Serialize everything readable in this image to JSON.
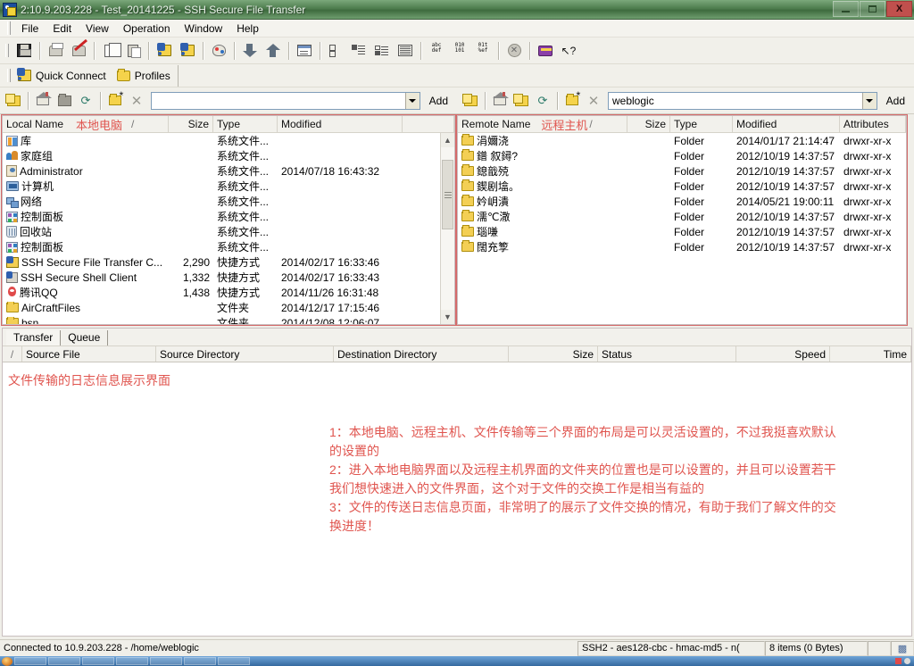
{
  "window": {
    "title": "2:10.9.203.228 - Test_20141225 - SSH Secure File Transfer",
    "icon": "ssh-file-transfer-icon",
    "minimize_label": "Minimize",
    "maximize_label": "Maximize",
    "close_label": "X"
  },
  "menu": {
    "items": [
      {
        "label": "File"
      },
      {
        "label": "Edit"
      },
      {
        "label": "View"
      },
      {
        "label": "Operation"
      },
      {
        "label": "Window"
      },
      {
        "label": "Help"
      }
    ]
  },
  "toolbar": {
    "buttons": [
      {
        "name": "save-icon"
      },
      {
        "name": "print-icon"
      },
      {
        "name": "print-preview-icon"
      },
      {
        "name": "copy-icon"
      },
      {
        "name": "paste-icon"
      },
      {
        "name": "new-terminal-icon"
      },
      {
        "name": "new-file-transfer-icon"
      },
      {
        "name": "settings-palette-icon"
      },
      {
        "name": "download-arrow-icon"
      },
      {
        "name": "upload-arrow-icon"
      },
      {
        "name": "window-view-icon"
      },
      {
        "name": "view-large-icons-icon"
      },
      {
        "name": "view-small-icons-icon"
      },
      {
        "name": "view-list-icon"
      },
      {
        "name": "view-details-icon"
      },
      {
        "name": "ascii-mode-icon"
      },
      {
        "name": "binary-mode-icon"
      },
      {
        "name": "auto-mode-icon"
      },
      {
        "name": "stop-icon"
      },
      {
        "name": "help-book-icon"
      },
      {
        "name": "context-help-icon"
      }
    ],
    "ascii_lines": [
      "abc",
      "def"
    ],
    "binary_lines": [
      "010",
      "101"
    ],
    "auto_lines": [
      "01t",
      "%ef"
    ]
  },
  "quickbar": {
    "quick_connect": "Quick Connect",
    "profiles": "Profiles"
  },
  "address": {
    "local": {
      "value": "",
      "placeholder": "",
      "add_label": "Add",
      "buttons": [
        {
          "name": "up-one-level-icon"
        },
        {
          "name": "home-icon"
        },
        {
          "name": "go-to-folder-icon"
        },
        {
          "name": "refresh-icon"
        },
        {
          "name": "new-folder-icon"
        },
        {
          "name": "delete-icon"
        }
      ]
    },
    "remote": {
      "value": "weblogic",
      "placeholder": "",
      "add_label": "Add",
      "buttons": [
        {
          "name": "up-one-level-icon"
        },
        {
          "name": "home-icon"
        },
        {
          "name": "go-to-folder-icon"
        },
        {
          "name": "refresh-icon"
        },
        {
          "name": "new-folder-icon"
        },
        {
          "name": "delete-icon"
        }
      ]
    }
  },
  "local_pane": {
    "annotation": "本地电脑",
    "sort_indicator": "/",
    "columns": [
      "Local Name",
      "Size",
      "Type",
      "Modified",
      ""
    ],
    "rows": [
      {
        "icon": "library-icon",
        "name": "库",
        "size": "",
        "type": "系统文件...",
        "modified": ""
      },
      {
        "icon": "homegroup-icon",
        "name": "家庭组",
        "size": "",
        "type": "系统文件...",
        "modified": ""
      },
      {
        "icon": "user-icon",
        "name": "Administrator",
        "size": "",
        "type": "系统文件...",
        "modified": "2014/07/18 16:43:32"
      },
      {
        "icon": "computer-icon",
        "name": "计算机",
        "size": "",
        "type": "系统文件...",
        "modified": ""
      },
      {
        "icon": "network-icon",
        "name": "网络",
        "size": "",
        "type": "系统文件...",
        "modified": ""
      },
      {
        "icon": "control-panel-icon",
        "name": "控制面板",
        "size": "",
        "type": "系统文件...",
        "modified": ""
      },
      {
        "icon": "recycle-bin-icon",
        "name": "回收站",
        "size": "",
        "type": "系统文件...",
        "modified": ""
      },
      {
        "icon": "control-panel-icon",
        "name": "控制面板",
        "size": "",
        "type": "系统文件...",
        "modified": ""
      },
      {
        "icon": "ssh-transfer-icon",
        "name": "SSH Secure File Transfer C...",
        "size": "2,290",
        "type": "快捷方式",
        "modified": "2014/02/17 16:33:46"
      },
      {
        "icon": "ssh-shell-icon",
        "name": "SSH Secure Shell Client",
        "size": "1,332",
        "type": "快捷方式",
        "modified": "2014/02/17 16:33:43"
      },
      {
        "icon": "qq-icon",
        "name": "腾讯QQ",
        "size": "1,438",
        "type": "快捷方式",
        "modified": "2014/11/26 16:31:48"
      },
      {
        "icon": "folder-icon",
        "name": "AirCraftFiles",
        "size": "",
        "type": "文件夹",
        "modified": "2014/12/17 17:15:46"
      },
      {
        "icon": "folder-icon",
        "name": "bsn",
        "size": "",
        "type": "文件夹",
        "modified": "2014/12/08 12:06:07"
      }
    ]
  },
  "remote_pane": {
    "annotation": "远程主机",
    "sort_indicator": "/",
    "columns": [
      "Remote Name",
      "Size",
      "Type",
      "Modified",
      "Attributes"
    ],
    "rows": [
      {
        "icon": "folder-icon",
        "name": "涓嬭浇",
        "size": "",
        "type": "Folder",
        "modified": "2014/01/17 21:14:47",
        "attributes": "drwxr-xr-x"
      },
      {
        "icon": "folder-icon",
        "name": "鐠  叙鐞?",
        "size": "",
        "type": "Folder",
        "modified": "2012/10/19 14:37:57",
        "attributes": "drwxr-xr-x"
      },
      {
        "icon": "folder-icon",
        "name": "鎴戠殑",
        "size": "",
        "type": "Folder",
        "modified": "2012/10/19 14:37:57",
        "attributes": "drwxr-xr-x"
      },
      {
        "icon": "folder-icon",
        "name": "鍥剧墖。",
        "size": "",
        "type": "Folder",
        "modified": "2012/10/19 14:37:57",
        "attributes": "drwxr-xr-x"
      },
      {
        "icon": "folder-icon",
        "name": "妗岄潰",
        "size": "",
        "type": "Folder",
        "modified": "2014/05/21 19:00:11",
        "attributes": "drwxr-xr-x"
      },
      {
        "icon": "folder-icon",
        "name": "濡℃潵",
        "size": "",
        "type": "Folder",
        "modified": "2012/10/19 14:37:57",
        "attributes": "drwxr-xr-x"
      },
      {
        "icon": "folder-icon",
        "name": "瑙嗛",
        "size": "",
        "type": "Folder",
        "modified": "2012/10/19 14:37:57",
        "attributes": "drwxr-xr-x"
      },
      {
        "icon": "folder-icon",
        "name": "闊充箰",
        "size": "",
        "type": "Folder",
        "modified": "2012/10/19 14:37:57",
        "attributes": "drwxr-xr-x"
      }
    ]
  },
  "transfer_panel": {
    "tabs": [
      {
        "label": "Transfer",
        "active": true
      },
      {
        "label": "Queue",
        "active": false
      }
    ],
    "columns": [
      "/",
      "Source File",
      "Source Directory",
      "Destination Directory",
      "Size",
      "Status",
      "Speed",
      "Time"
    ],
    "rows": [],
    "annotation_title": "文件传输的日志信息展示界面",
    "annotation_lines": [
      "1：本地电脑、远程主机、文件传输等三个界面的布局是可以灵活设置的，不过我挺喜欢默认",
      "的设置的",
      "2：进入本地电脑界面以及远程主机界面的文件夹的位置也是可以设置的，并且可以设置若干",
      "我们想快速进入的文件界面，这个对于文件的交换工作是相当有益的",
      "3：文件的传送日志信息页面，非常明了的展示了文件交换的情况，有助于我们了解文件的交",
      "换进度！"
    ]
  },
  "statusbar": {
    "connection": "Connected to 10.9.203.228 - /home/weblogic",
    "cipher": "SSH2 - aes128-cbc - hmac-md5 - n(",
    "items": "8 items (0 Bytes)",
    "lock_icon": "secure-icon"
  },
  "colors": {
    "title_green": "#4e7d4e",
    "annotation_red": "#e0554f",
    "frame_red": "#d46a6a",
    "taskbar_blue": "#35699f"
  }
}
